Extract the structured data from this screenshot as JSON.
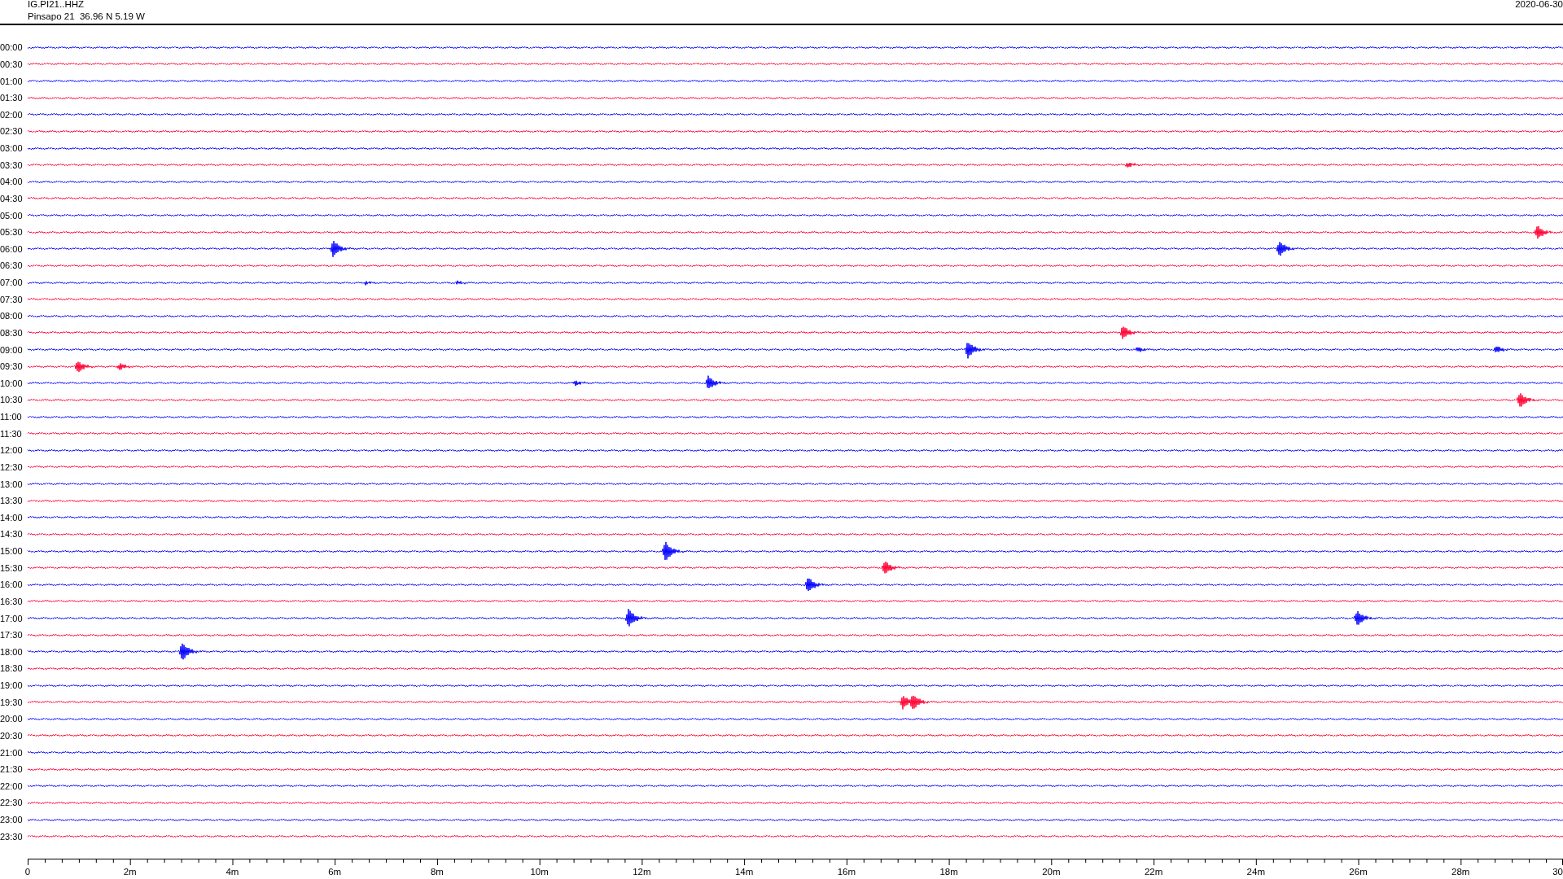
{
  "header": {
    "station": "IG.PI21..HHZ",
    "location": "Pinsapo 21  36.96 N 5.19 W",
    "date": "2020-06-30"
  },
  "helicorder": {
    "rows": [
      {
        "label": "00:00",
        "color": "#0000ff"
      },
      {
        "label": "00:30",
        "color": "#ff0033"
      },
      {
        "label": "01:00",
        "color": "#0000ff"
      },
      {
        "label": "01:30",
        "color": "#ff0033"
      },
      {
        "label": "02:00",
        "color": "#0000ff"
      },
      {
        "label": "02:30",
        "color": "#ff0033"
      },
      {
        "label": "03:00",
        "color": "#0000ff"
      },
      {
        "label": "03:30",
        "color": "#ff0033"
      },
      {
        "label": "04:00",
        "color": "#0000ff"
      },
      {
        "label": "04:30",
        "color": "#ff0033"
      },
      {
        "label": "05:00",
        "color": "#0000ff"
      },
      {
        "label": "05:30",
        "color": "#ff0033"
      },
      {
        "label": "06:00",
        "color": "#0000ff"
      },
      {
        "label": "06:30",
        "color": "#ff0033"
      },
      {
        "label": "07:00",
        "color": "#0000ff"
      },
      {
        "label": "07:30",
        "color": "#ff0033"
      },
      {
        "label": "08:00",
        "color": "#0000ff"
      },
      {
        "label": "08:30",
        "color": "#ff0033"
      },
      {
        "label": "09:00",
        "color": "#0000ff"
      },
      {
        "label": "09:30",
        "color": "#ff0033"
      },
      {
        "label": "10:00",
        "color": "#0000ff"
      },
      {
        "label": "10:30",
        "color": "#ff0033"
      },
      {
        "label": "11:00",
        "color": "#0000ff"
      },
      {
        "label": "11:30",
        "color": "#ff0033"
      },
      {
        "label": "12:00",
        "color": "#0000ff"
      },
      {
        "label": "12:30",
        "color": "#ff0033"
      },
      {
        "label": "13:00",
        "color": "#0000ff"
      },
      {
        "label": "13:30",
        "color": "#ff0033"
      },
      {
        "label": "14:00",
        "color": "#0000ff"
      },
      {
        "label": "14:30",
        "color": "#ff0033"
      },
      {
        "label": "15:00",
        "color": "#0000ff"
      },
      {
        "label": "15:30",
        "color": "#ff0033"
      },
      {
        "label": "16:00",
        "color": "#0000ff"
      },
      {
        "label": "16:30",
        "color": "#ff0033"
      },
      {
        "label": "17:00",
        "color": "#0000ff"
      },
      {
        "label": "17:30",
        "color": "#ff0033"
      },
      {
        "label": "18:00",
        "color": "#0000ff"
      },
      {
        "label": "18:30",
        "color": "#ff0033"
      },
      {
        "label": "19:00",
        "color": "#0000ff"
      },
      {
        "label": "19:30",
        "color": "#ff0033"
      },
      {
        "label": "20:00",
        "color": "#0000ff"
      },
      {
        "label": "20:30",
        "color": "#ff0033"
      },
      {
        "label": "21:00",
        "color": "#0000ff"
      },
      {
        "label": "21:30",
        "color": "#ff0033"
      },
      {
        "label": "22:00",
        "color": "#0000ff"
      },
      {
        "label": "22:30",
        "color": "#ff0033"
      },
      {
        "label": "23:00",
        "color": "#0000ff"
      },
      {
        "label": "23:30",
        "color": "#ff0033"
      }
    ],
    "x_axis": {
      "labels": [
        "0",
        "2m",
        "4m",
        "6m",
        "8m",
        "10m",
        "12m",
        "14m",
        "16m",
        "18m",
        "20m",
        "22m",
        "24m",
        "26m",
        "28m",
        "30"
      ]
    }
  }
}
